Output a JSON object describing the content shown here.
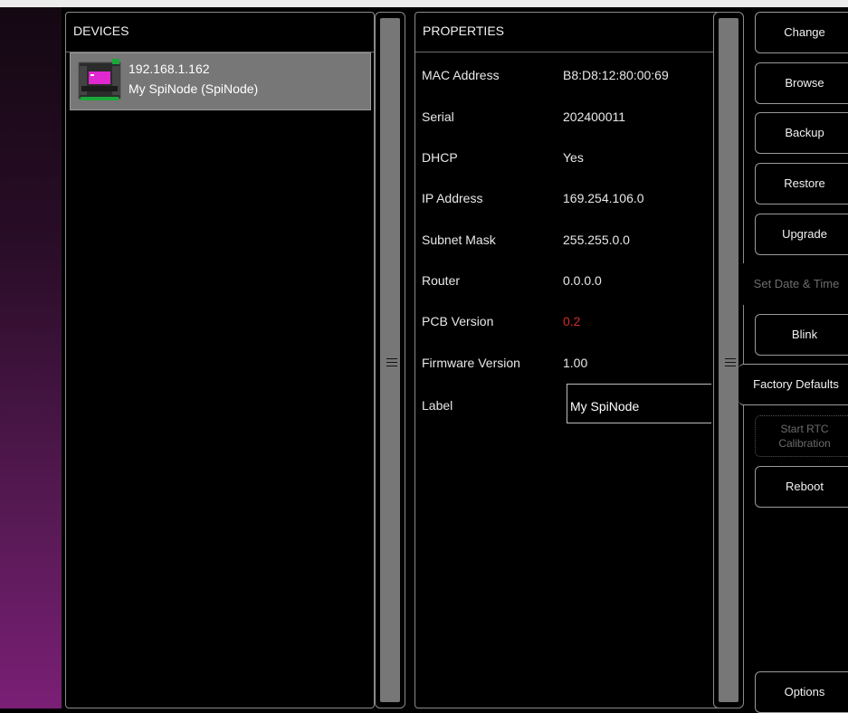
{
  "devices_panel": {
    "title": "DEVICES",
    "items": [
      {
        "ip": "192.168.1.162",
        "name": "My SpiNode  (SpiNode)"
      }
    ]
  },
  "properties_panel": {
    "title": "PROPERTIES",
    "rows": [
      {
        "label": "MAC Address",
        "value": "B8:D8:12:80:00:69"
      },
      {
        "label": "Serial",
        "value": "202400011"
      },
      {
        "label": "DHCP",
        "value": "Yes"
      },
      {
        "label": "IP Address",
        "value": "169.254.106.0"
      },
      {
        "label": "Subnet Mask",
        "value": "255.255.0.0"
      },
      {
        "label": "Router",
        "value": "0.0.0.0"
      },
      {
        "label": "PCB Version",
        "value": "0.2",
        "value_color": "#d42a2a"
      },
      {
        "label": "Firmware Version",
        "value": "1.00"
      },
      {
        "label": "Label",
        "value": "My SpiNode"
      }
    ]
  },
  "actions": {
    "change": "Change",
    "browse": "Browse",
    "backup": "Backup",
    "restore": "Restore",
    "upgrade": "Upgrade",
    "set_date_time": "Set Date & Time",
    "blink": "Blink",
    "factory_defaults": "Factory Defaults",
    "start_rtc_calibration": "Start RTC Calibration",
    "reboot": "Reboot",
    "options": "Options"
  },
  "colors": {
    "accent": "#7a1f76",
    "warning_value": "#d42a2a"
  }
}
